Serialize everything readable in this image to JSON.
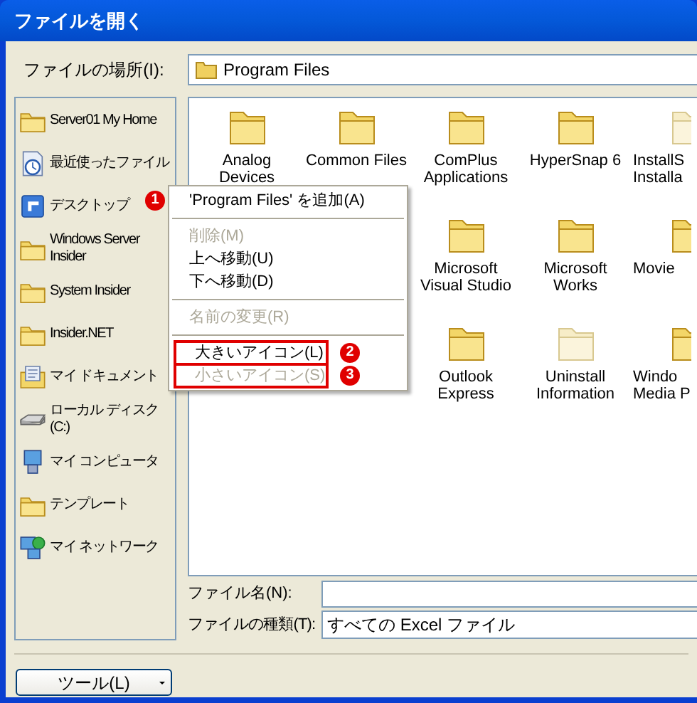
{
  "window": {
    "title": "ファイルを開く"
  },
  "location": {
    "label": "ファイルの場所(I):",
    "value": "Program Files"
  },
  "sidebar": {
    "items": [
      {
        "kind": "folder",
        "label": "Server01 My Home"
      },
      {
        "kind": "recent",
        "label": "最近使ったファイル"
      },
      {
        "kind": "desktop",
        "label": "デスクトップ"
      },
      {
        "kind": "folder",
        "label": "Windows Server Insider"
      },
      {
        "kind": "folder",
        "label": "System Insider"
      },
      {
        "kind": "folder",
        "label": "Insider.NET"
      },
      {
        "kind": "documents",
        "label": "マイ ドキュメント"
      },
      {
        "kind": "drive",
        "label": "ローカル ディスク (C:)"
      },
      {
        "kind": "computer",
        "label": "マイ コンピュータ"
      },
      {
        "kind": "folder",
        "label": "テンプレート"
      },
      {
        "kind": "network",
        "label": "マイ ネットワーク"
      }
    ]
  },
  "files": {
    "rows": [
      [
        {
          "lines": [
            "Analog",
            "Devices"
          ],
          "faded": false
        },
        {
          "lines": [
            "Common Files"
          ],
          "faded": false
        },
        {
          "lines": [
            "ComPlus",
            "Applications"
          ],
          "faded": false
        },
        {
          "lines": [
            "HyperSnap 6"
          ],
          "faded": false
        },
        {
          "lines": [
            "InstallS",
            "Installa"
          ],
          "faded": true
        }
      ],
      [
        "",
        "",
        {
          "lines": [
            "Microsoft",
            "Visual Studio"
          ],
          "faded": false
        },
        {
          "lines": [
            "Microsoft",
            "Works"
          ],
          "faded": false
        },
        {
          "lines": [
            "Movie"
          ],
          "faded": false
        }
      ],
      [
        "",
        "",
        {
          "lines": [
            "Outlook",
            "Express"
          ],
          "faded": false
        },
        {
          "lines": [
            "Uninstall",
            "Information"
          ],
          "faded": true
        },
        {
          "lines": [
            "Windo",
            "Media P"
          ],
          "faded": false
        }
      ]
    ]
  },
  "context_menu": {
    "items": [
      {
        "kind": "item",
        "label": "'Program Files' を追加(A)",
        "disabled": false,
        "highlighted": false,
        "callout": "1"
      },
      {
        "kind": "separator"
      },
      {
        "kind": "item",
        "label": "削除(M)",
        "disabled": true,
        "highlighted": false
      },
      {
        "kind": "item",
        "label": "上へ移動(U)",
        "disabled": false,
        "highlighted": false
      },
      {
        "kind": "item",
        "label": "下へ移動(D)",
        "disabled": false,
        "highlighted": false
      },
      {
        "kind": "separator"
      },
      {
        "kind": "item",
        "label": "名前の変更(R)",
        "disabled": true,
        "highlighted": false
      },
      {
        "kind": "separator"
      },
      {
        "kind": "item",
        "label": "大きいアイコン(L)",
        "disabled": false,
        "highlighted": true,
        "callout": "2"
      },
      {
        "kind": "item",
        "label": "小さいアイコン(S)",
        "disabled": true,
        "highlighted": true,
        "callout": "3"
      }
    ]
  },
  "filename": {
    "label": "ファイル名(N):"
  },
  "filetype": {
    "label": "ファイルの種類(T):",
    "value": "すべての Excel ファイル"
  },
  "tools_button": {
    "label": "ツール(L)"
  }
}
